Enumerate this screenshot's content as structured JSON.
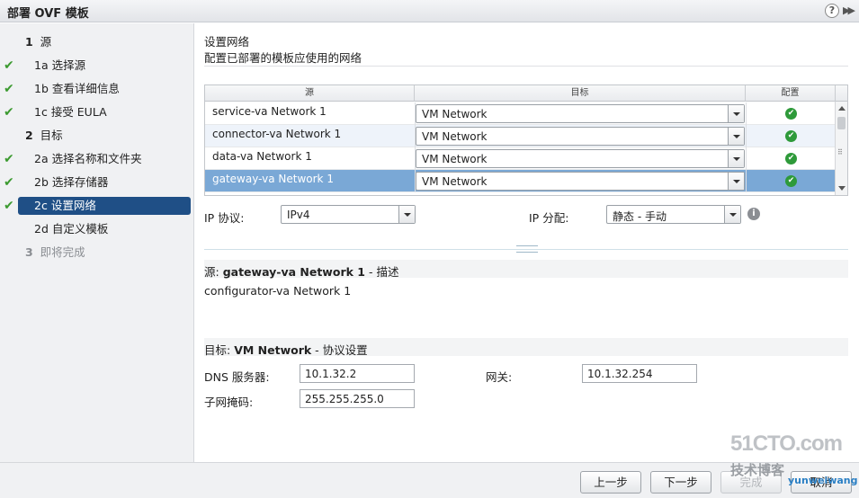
{
  "window": {
    "title": "部署 OVF 模板",
    "help": "?",
    "expand": "▶▶"
  },
  "steps": [
    {
      "num": "1",
      "label": "源",
      "check": false,
      "state": "normal"
    },
    {
      "num": "1a",
      "label": "选择源",
      "check": true,
      "state": "normal"
    },
    {
      "num": "1b",
      "label": "查看详细信息",
      "check": true,
      "state": "normal"
    },
    {
      "num": "1c",
      "label": "接受 EULA",
      "check": true,
      "state": "normal"
    },
    {
      "num": "2",
      "label": "目标",
      "check": false,
      "state": "normal"
    },
    {
      "num": "2a",
      "label": "选择名称和文件夹",
      "check": true,
      "state": "normal"
    },
    {
      "num": "2b",
      "label": "选择存储器",
      "check": true,
      "state": "normal"
    },
    {
      "num": "2c",
      "label": "设置网络",
      "check": true,
      "state": "active"
    },
    {
      "num": "2d",
      "label": "自定义模板",
      "check": false,
      "state": "normal"
    },
    {
      "num": "3",
      "label": "即将完成",
      "check": false,
      "state": "muted"
    }
  ],
  "header": {
    "title": "设置网络",
    "subtitle": "配置已部署的模板应使用的网络"
  },
  "network_table": {
    "columns": [
      "源",
      "目标",
      "配置"
    ],
    "rows": [
      {
        "source": "service-va Network 1",
        "dest": "VM Network",
        "ok": "✔"
      },
      {
        "source": "connector-va Network 1",
        "dest": "VM Network",
        "ok": "✔"
      },
      {
        "source": "data-va Network 1",
        "dest": "VM Network",
        "ok": "✔"
      },
      {
        "source": "gateway-va Network 1",
        "dest": "VM Network",
        "ok": "✔"
      }
    ]
  },
  "ip_protocol": {
    "label": "IP 协议:",
    "value": "IPv4"
  },
  "ip_allocation": {
    "label": "IP 分配:",
    "value": "静态 - 手动"
  },
  "source_section": {
    "prefix": "源: ",
    "name": "gateway-va Network 1",
    "suffix": " - 描述",
    "description": "configurator-va Network 1"
  },
  "dest_section": {
    "prefix": "目标: ",
    "name": "VM Network",
    "suffix": " - 协议设置",
    "dns_label": "DNS 服务器:",
    "dns_value": "10.1.32.2",
    "gateway_label": "网关:",
    "gateway_value": "10.1.32.254",
    "netmask_label": "子网掩码:",
    "netmask_value": "255.255.255.0"
  },
  "footer": {
    "back": "上一步",
    "next": "下一步",
    "finish": "完成",
    "cancel": "取消"
  },
  "watermark": {
    "line1": "51CTO.com",
    "line2": "技术博客",
    "line3": "yunweiwang"
  }
}
